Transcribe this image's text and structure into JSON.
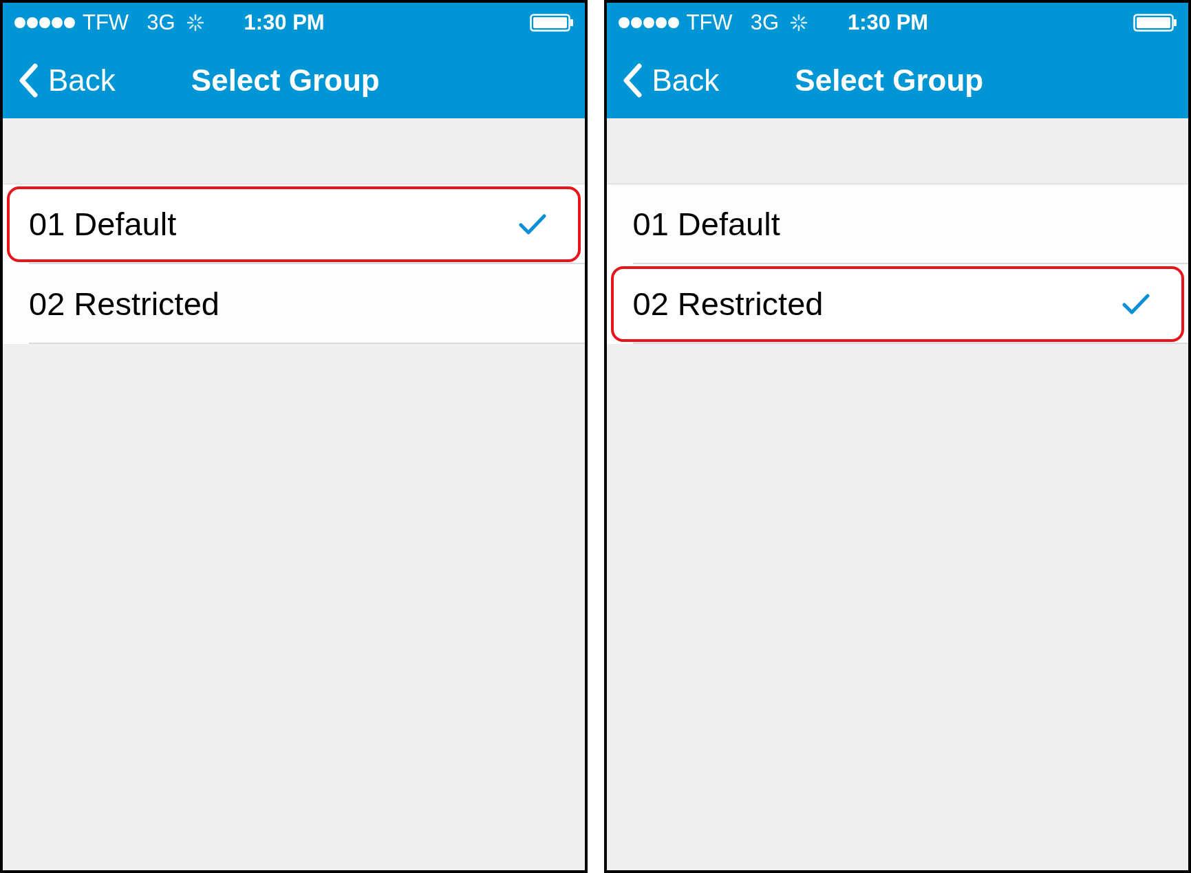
{
  "phones": [
    {
      "status_bar": {
        "carrier": "TFW",
        "network": "3G",
        "time": "1:30 PM"
      },
      "nav": {
        "back": "Back",
        "title": "Select Group"
      },
      "items": [
        {
          "label": "01 Default",
          "selected": true
        },
        {
          "label": "02 Restricted",
          "selected": false
        }
      ]
    },
    {
      "status_bar": {
        "carrier": "TFW",
        "network": "3G",
        "time": "1:30 PM"
      },
      "nav": {
        "back": "Back",
        "title": "Select Group"
      },
      "items": [
        {
          "label": "01 Default",
          "selected": false
        },
        {
          "label": "02 Restricted",
          "selected": true
        }
      ]
    }
  ]
}
